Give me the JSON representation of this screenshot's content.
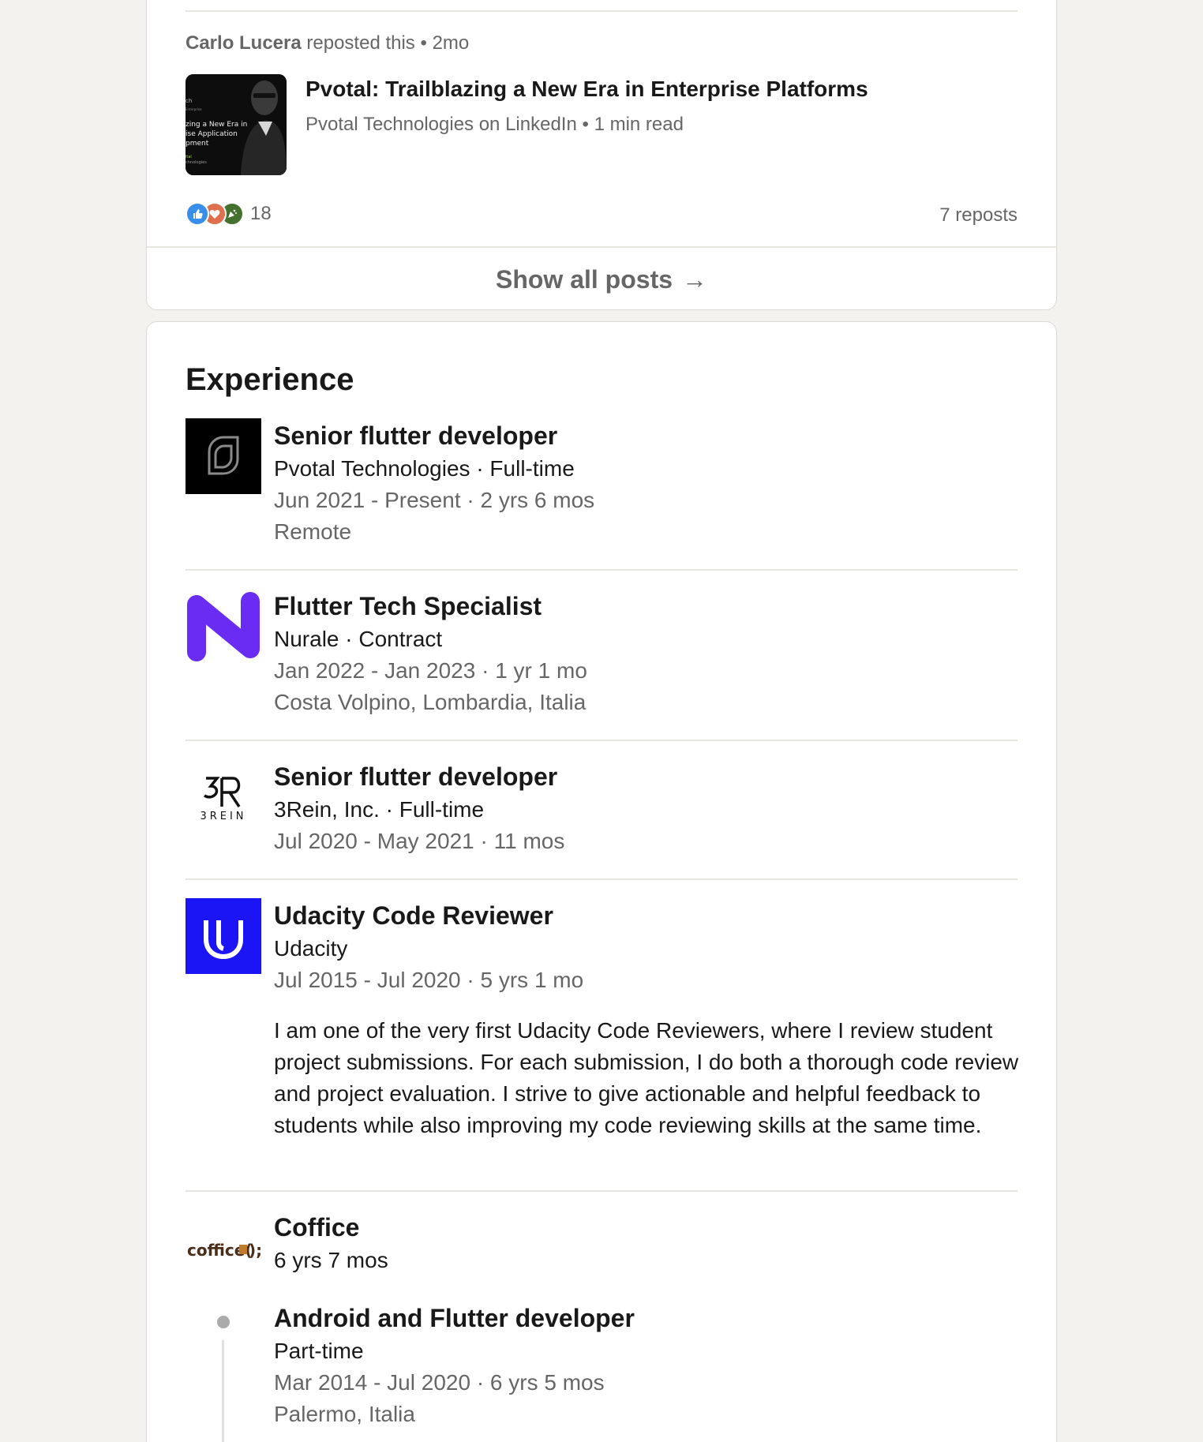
{
  "posts": {
    "repost_author": "Carlo Lucera",
    "repost_action": "reposted this",
    "repost_time": "2mo",
    "thumb_lines": [
      "ch",
      "Enterprise",
      "zing a New Era in",
      "ise Application",
      "pment",
      "ital",
      "chnologies"
    ],
    "title": "Pvotal: Trailblazing a New Era in Enterprise Platforms",
    "source": "Pvotal Technologies on LinkedIn",
    "read_time": "1 min read",
    "reaction_count": "18",
    "reposts": "7 reposts",
    "show_all": "Show all posts",
    "arrow": "→"
  },
  "experience": {
    "title": "Experience",
    "entries": [
      {
        "role": "Senior flutter developer",
        "company": "Pvotal Technologies · Full-time",
        "dates": "Jun 2021 - Present · 2 yrs 6 mos",
        "location": "Remote"
      },
      {
        "role": "Flutter Tech Specialist",
        "company": "Nurale · Contract",
        "dates": "Jan 2022 - Jan 2023 · 1 yr 1 mo",
        "location": "Costa Volpino, Lombardia, Italia"
      },
      {
        "role": "Senior flutter developer",
        "company": "3Rein, Inc. · Full-time",
        "dates": "Jul 2020 - May 2021 · 11 mos",
        "logo_text": "3REIN"
      },
      {
        "role": "Udacity Code Reviewer",
        "company": "Udacity",
        "dates": "Jul 2015 - Jul 2020 · 5 yrs 1 mo",
        "description": "I am one of the very first Udacity Code Reviewers, where I review student project submissions. For each submission, I do both a thorough code review and project evaluation. I strive to give actionable and helpful feedback to students while also improving my code reviewing skills at the same time."
      },
      {
        "role": "Coffice",
        "duration": "6 yrs 7 mos",
        "logo_text": "coffice(",
        "logo_text_end": ");",
        "sub": {
          "role": "Android and Flutter developer",
          "type": "Part-time",
          "dates": "Mar 2014 - Jul 2020 · 6 yrs 5 mos",
          "location": "Palermo, Italia"
        }
      }
    ]
  },
  "colors": {
    "page_bg": "#f3f2ef",
    "udacity_blue": "#1b14f5",
    "nurale_purple": "#6a2cf2",
    "muted_text": "#666666"
  }
}
